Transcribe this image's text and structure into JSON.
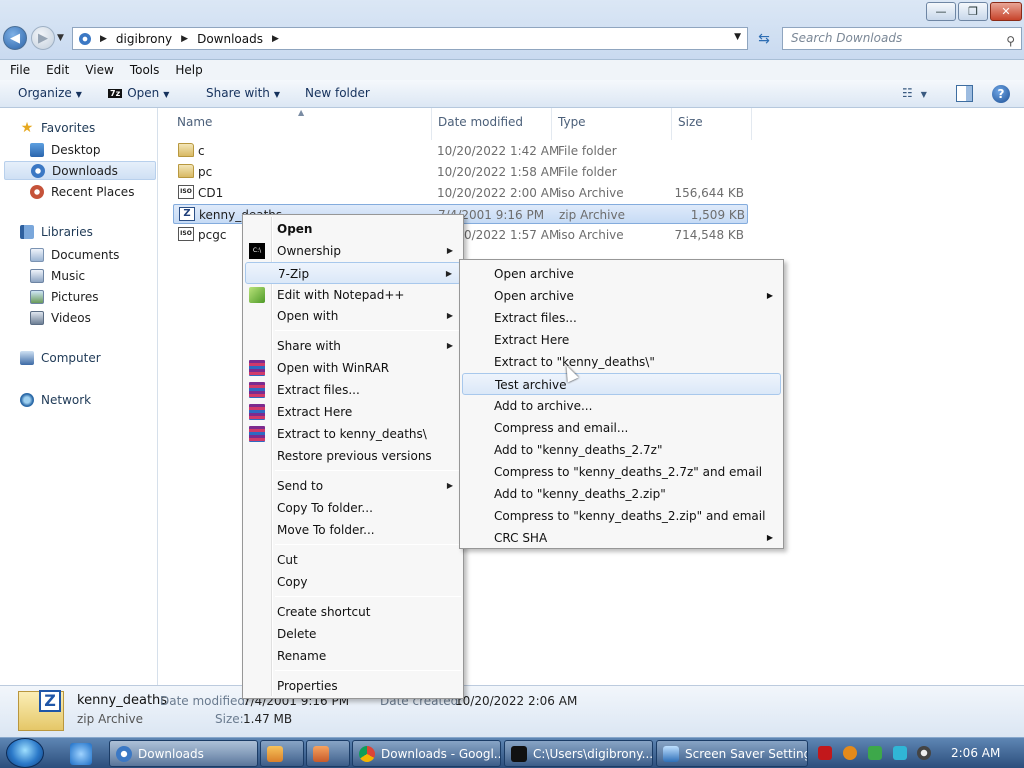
{
  "window": {
    "minimize_glyph": "—",
    "maximize_glyph": "❐",
    "close_glyph": "✕"
  },
  "address": {
    "crumbs": [
      "digibrony",
      "Downloads"
    ],
    "search_placeholder": "Search Downloads"
  },
  "menu": [
    "File",
    "Edit",
    "View",
    "Tools",
    "Help"
  ],
  "toolbar": {
    "organize": "Organize",
    "open": "Open",
    "open_badge": "7z",
    "share_with": "Share with",
    "new_folder": "New folder"
  },
  "nav": {
    "favorites": "Favorites",
    "desktop": "Desktop",
    "downloads": "Downloads",
    "recent": "Recent Places",
    "libraries": "Libraries",
    "documents": "Documents",
    "music": "Music",
    "pictures": "Pictures",
    "videos": "Videos",
    "computer": "Computer",
    "network": "Network"
  },
  "columns": {
    "name": "Name",
    "date": "Date modified",
    "type": "Type",
    "size": "Size"
  },
  "files": [
    {
      "name": "c",
      "date": "10/20/2022 1:42 AM",
      "type": "File folder",
      "size": "",
      "icon": "folder-icon"
    },
    {
      "name": "pc",
      "date": "10/20/2022 1:58 AM",
      "type": "File folder",
      "size": "",
      "icon": "folder-icon"
    },
    {
      "name": "CD1",
      "date": "10/20/2022 2:00 AM",
      "type": "iso Archive",
      "size": "156,644 KB",
      "icon": "iso-icon"
    },
    {
      "name": "kenny_deaths",
      "date": "7/4/2001 9:16 PM",
      "type": "zip Archive",
      "size": "1,509 KB",
      "icon": "zip-icon"
    },
    {
      "name": "pcgc",
      "date": "10/20/2022 1:57 AM",
      "type": "iso Archive",
      "size": "714,548 KB",
      "icon": "iso-icon"
    }
  ],
  "context_menu": {
    "open": "Open",
    "ownership": "Ownership",
    "sevenzip": "7-Zip",
    "edit_npp": "Edit with Notepad++",
    "open_with": "Open with",
    "share_with": "Share with",
    "open_winrar": "Open with WinRAR",
    "extract_files": "Extract files...",
    "extract_here": "Extract Here",
    "extract_to": "Extract to kenny_deaths\\",
    "restore": "Restore previous versions",
    "send_to": "Send to",
    "copy_to": "Copy To folder...",
    "move_to": "Move To folder...",
    "cut": "Cut",
    "copy": "Copy",
    "create_shortcut": "Create shortcut",
    "delete": "Delete",
    "rename": "Rename",
    "properties": "Properties",
    "cmd_badge": "C:\\"
  },
  "sevenzip_menu": [
    {
      "label": "Open archive",
      "sub": false
    },
    {
      "label": "Open archive",
      "sub": true
    },
    {
      "label": "Extract files...",
      "sub": false
    },
    {
      "label": "Extract Here",
      "sub": false
    },
    {
      "label": "Extract to \"kenny_deaths\\\"",
      "sub": false
    },
    {
      "label": "Test archive",
      "sub": false
    },
    {
      "label": "Add to archive...",
      "sub": false
    },
    {
      "label": "Compress and email...",
      "sub": false
    },
    {
      "label": "Add to \"kenny_deaths_2.7z\"",
      "sub": false
    },
    {
      "label": "Compress to \"kenny_deaths_2.7z\" and email",
      "sub": false
    },
    {
      "label": "Add to \"kenny_deaths_2.zip\"",
      "sub": false
    },
    {
      "label": "Compress to \"kenny_deaths_2.zip\" and email",
      "sub": false
    },
    {
      "label": "CRC SHA",
      "sub": true
    }
  ],
  "details": {
    "name": "kenny_deaths",
    "type": "zip Archive",
    "date_modified_label": "Date modified:",
    "date_modified": "7/4/2001 9:16 PM",
    "date_created_label": "Date created:",
    "date_created": "10/20/2022 2:06 AM",
    "size_label": "Size:",
    "size": "1.47 MB",
    "icon_badge": "Z"
  },
  "taskbar": {
    "buttons": [
      {
        "label": "Downloads",
        "active": true
      },
      {
        "label": "",
        "active": false
      },
      {
        "label": "",
        "active": false
      },
      {
        "label": "Downloads - Googl...",
        "active": false
      },
      {
        "label": "C:\\Users\\digibrony...",
        "active": false
      },
      {
        "label": "Screen Saver Settings",
        "active": false
      }
    ],
    "clock": "2:06 AM"
  },
  "colors": {
    "selection": "#cfe0f4",
    "taskbar": "#2c4e7c",
    "accent": "#1f56a8"
  }
}
